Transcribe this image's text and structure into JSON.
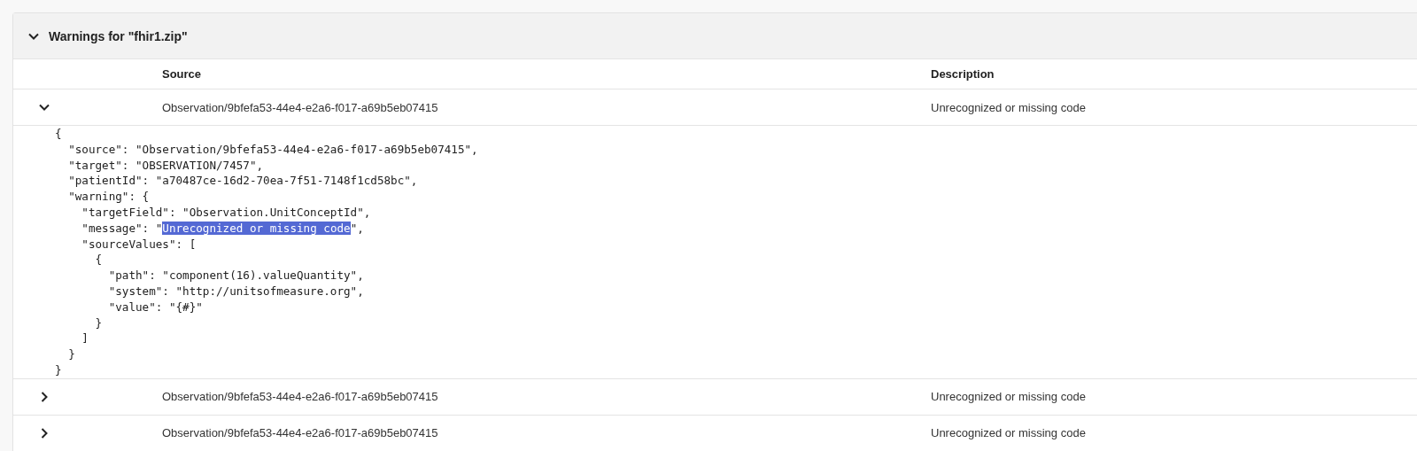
{
  "panel": {
    "title": "Warnings for \"fhir1.zip\"",
    "expanded": true
  },
  "table": {
    "columns": [
      "Source",
      "Description"
    ],
    "rows": [
      {
        "expanded": true,
        "source": "Observation/9bfefa53-44e4-e2a6-f017-a69b5eb07415",
        "description": "Unrecognized or missing code",
        "detail": [
          {
            "text": "{"
          },
          {
            "text": "  \"source\": \"Observation/9bfefa53-44e4-e2a6-f017-a69b5eb07415\","
          },
          {
            "text": "  \"target\": \"OBSERVATION/7457\","
          },
          {
            "text": "  \"patientId\": \"a70487ce-16d2-70ea-7f51-7148f1cd58bc\","
          },
          {
            "text": "  \"warning\": {"
          },
          {
            "text": "    \"targetField\": \"Observation.UnitConceptId\","
          },
          {
            "text": "    \"message\": \"",
            "selected_text": "Unrecognized or missing code",
            "after": "\","
          },
          {
            "text": "    \"sourceValues\": ["
          },
          {
            "text": "      {"
          },
          {
            "text": "        \"path\": \"component(16).valueQuantity\","
          },
          {
            "text": "        \"system\": \"http://unitsofmeasure.org\","
          },
          {
            "text": "        \"value\": \"{#}\""
          },
          {
            "text": "      }"
          },
          {
            "text": "    ]"
          },
          {
            "text": "  }"
          },
          {
            "text": "}"
          }
        ]
      },
      {
        "expanded": false,
        "source": "Observation/9bfefa53-44e4-e2a6-f017-a69b5eb07415",
        "description": "Unrecognized or missing code"
      },
      {
        "expanded": false,
        "source": "Observation/9bfefa53-44e4-e2a6-f017-a69b5eb07415",
        "description": "Unrecognized or missing code"
      }
    ]
  }
}
